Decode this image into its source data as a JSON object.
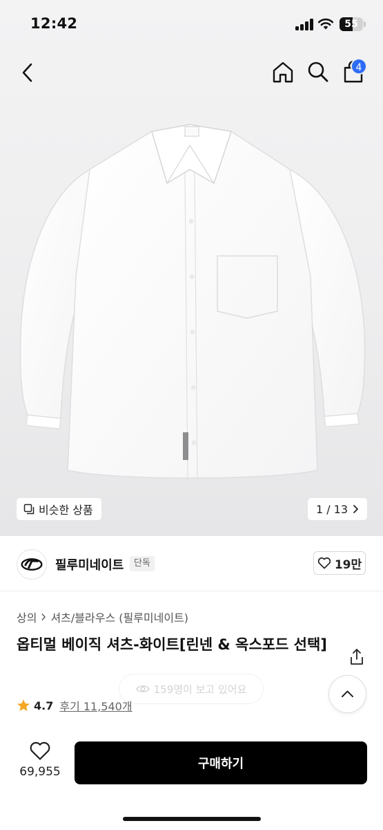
{
  "status_bar": {
    "time": "12:42",
    "battery_level": "55",
    "battery_fraction": 0.55
  },
  "header": {
    "cart_count": "4",
    "icons": [
      "chevron-left-icon",
      "home-icon",
      "search-icon",
      "cart-icon"
    ]
  },
  "gallery": {
    "similar_label": "비슷한 상품",
    "pager": "1 / 13"
  },
  "brand": {
    "name": "필루미네이트",
    "tag": "단독",
    "likes": "19만"
  },
  "breadcrumb": {
    "category": "상의",
    "subcategory": "셔츠/블라우스 (필루미네이트)"
  },
  "product": {
    "title": "옵티멀 베이직 셔츠-화이트[린넨 & 옥스포드 선택]",
    "rating": "4.7",
    "reviews": "후기 11,540개"
  },
  "toast": {
    "viewers": "159명이 보고 있어요"
  },
  "bottom_bar": {
    "wish_count": "69,955",
    "buy_label": "구매하기"
  },
  "colors": {
    "accent_badge": "#2d6cf6",
    "buy_button": "#000000",
    "star": "#f5a623"
  }
}
